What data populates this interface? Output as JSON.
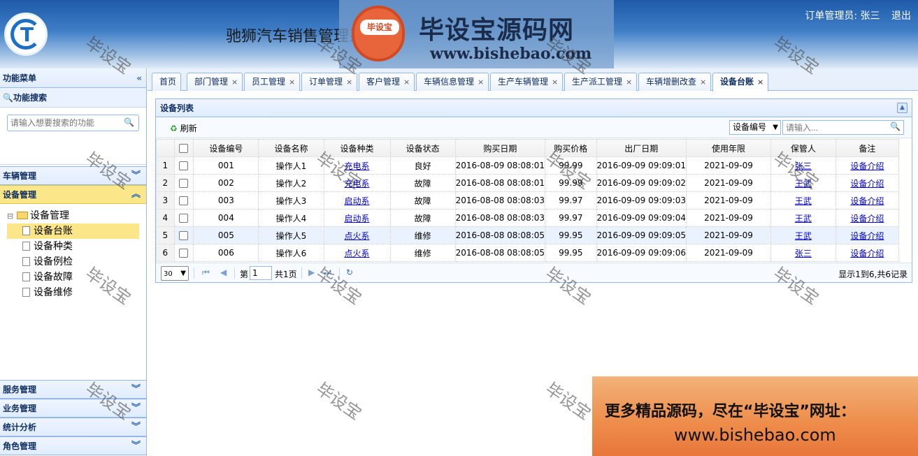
{
  "header": {
    "system_title": "驰狮汽车销售管理系统",
    "user_label": "订单管理员: 张三",
    "logout_label": "退出",
    "banner_badge": "毕设宝",
    "banner_title": "毕设宝源码网",
    "banner_url": "www.bishebao.com"
  },
  "sidebar": {
    "title": "功能菜单",
    "search_title": "功能搜索",
    "search_placeholder": "请输入想要搜索的功能",
    "groups_top": [
      {
        "label": "车辆管理"
      },
      {
        "label": "设备管理",
        "active": true
      }
    ],
    "tree": {
      "root": "设备管理",
      "children": [
        "设备台账",
        "设备种类",
        "设备例检",
        "设备故障",
        "设备维修"
      ],
      "selected": "设备台账"
    },
    "groups_bottom": [
      {
        "label": "服务管理"
      },
      {
        "label": "业务管理"
      },
      {
        "label": "统计分析"
      },
      {
        "label": "角色管理"
      }
    ]
  },
  "tabs": [
    "首页",
    "部门管理",
    "员工管理",
    "订单管理",
    "客户管理",
    "车辆信息管理",
    "生产车辆管理",
    "生产派工管理",
    "车辆增删改查",
    "设备台账"
  ],
  "active_tab": "设备台账",
  "panel": {
    "title": "设备列表",
    "refresh_label": "刷新",
    "search_field": "设备编号",
    "search_placeholder": "请输入..."
  },
  "grid": {
    "columns": [
      "设备编号",
      "设备名称",
      "设备种类",
      "设备状态",
      "购买日期",
      "购买价格",
      "出厂日期",
      "使用年限",
      "保管人",
      "备注"
    ],
    "rows": [
      {
        "n": "1",
        "id": "001",
        "name": "操作人1",
        "type": "充电系",
        "status": "良好",
        "buy_date": "2016-08-09 08:08:01",
        "price": "99.99",
        "factory_date": "2016-09-09 09:09:01",
        "years": "2021-09-09",
        "keeper": "张三",
        "note": "设备介绍"
      },
      {
        "n": "2",
        "id": "002",
        "name": "操作人2",
        "type": "充电系",
        "status": "故障",
        "buy_date": "2016-08-08 08:08:01",
        "price": "99.99",
        "factory_date": "2016-09-09 09:09:02",
        "years": "2021-09-09",
        "keeper": "王武",
        "note": "设备介绍"
      },
      {
        "n": "3",
        "id": "003",
        "name": "操作人3",
        "type": "启动系",
        "status": "故障",
        "buy_date": "2016-08-08 08:08:03",
        "price": "99.97",
        "factory_date": "2016-09-09 09:09:03",
        "years": "2021-09-09",
        "keeper": "王武",
        "note": "设备介绍"
      },
      {
        "n": "4",
        "id": "004",
        "name": "操作人4",
        "type": "启动系",
        "status": "故障",
        "buy_date": "2016-08-08 08:08:03",
        "price": "99.97",
        "factory_date": "2016-09-09 09:09:04",
        "years": "2021-09-09",
        "keeper": "王武",
        "note": "设备介绍"
      },
      {
        "n": "5",
        "id": "005",
        "name": "操作人5",
        "type": "点火系",
        "status": "维修",
        "buy_date": "2016-08-08 08:08:05",
        "price": "99.95",
        "factory_date": "2016-09-09 09:09:05",
        "years": "2021-09-09",
        "keeper": "王武",
        "note": "设备介绍"
      },
      {
        "n": "6",
        "id": "006",
        "name": "操作人6",
        "type": "点火系",
        "status": "维修",
        "buy_date": "2016-08-08 08:08:05",
        "price": "99.95",
        "factory_date": "2016-09-09 09:09:06",
        "years": "2021-09-09",
        "keeper": "张三",
        "note": "设备介绍"
      }
    ]
  },
  "pager": {
    "page_size": "30",
    "page_prefix": "第",
    "page_value": "1",
    "page_total": "共1页",
    "info": "显示1到6,共6记录"
  },
  "watermark": "毕设宝",
  "promo": {
    "line1": "更多精品源码，尽在“毕设宝”网址：",
    "line2": "www.bishebao.com"
  },
  "colors": {
    "accent": "#95b8e7",
    "active_menu": "#fbe78a",
    "link": "#0000cc"
  }
}
